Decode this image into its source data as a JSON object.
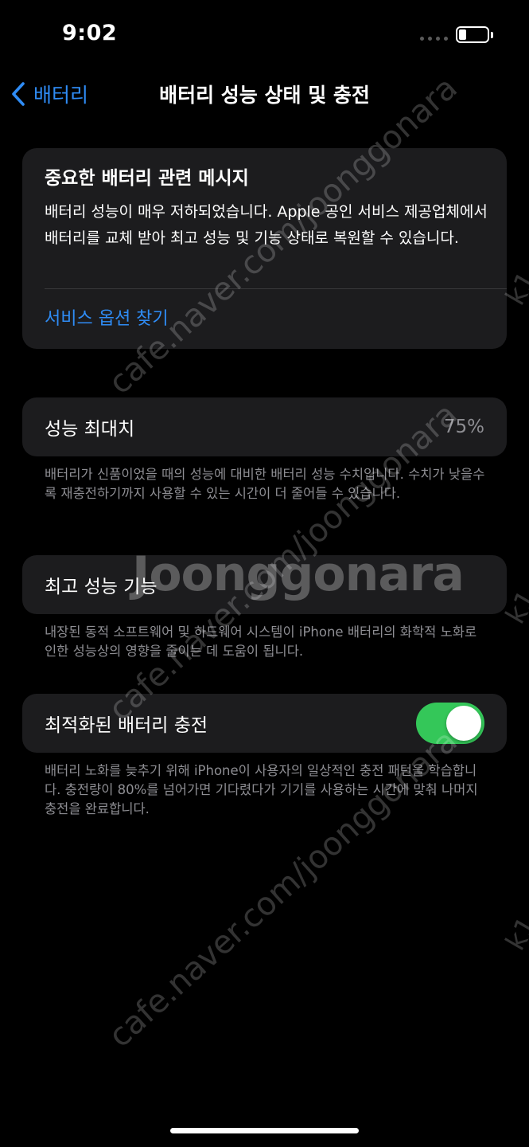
{
  "status_bar": {
    "time": "9:02",
    "battery_level": 0.25
  },
  "nav": {
    "back_label": "배터리",
    "title": "배터리 성능 상태 및 충전"
  },
  "message_card": {
    "title": "중요한 배터리 관련 메시지",
    "body": "배터리 성능이 매우 저하되었습니다. Apple 공인 서비스 제공업체에서 배터리를 교체 받아 최고 성능 및 기능 상태로 복원할 수 있습니다.",
    "link": "서비스 옵션 찾기"
  },
  "max_capacity": {
    "label": "성능 최대치",
    "value": "75%",
    "footnote": "배터리가 신품이었을 때의 성능에 대비한 배터리 성능 수치입니다. 수치가 낮을수록 재충전하기까지 사용할 수 있는 시간이 더 줄어들 수 있습니다."
  },
  "peak_performance": {
    "label": "최고 성능 기능",
    "footnote": "내장된 동적 소프트웨어 및 하드웨어 시스템이 iPhone 배터리의 화학적 노화로 인한 성능상의 영향을 줄이는 데 도움이 됩니다."
  },
  "optimized_charging": {
    "label": "최적화된 배터리 충전",
    "enabled": true,
    "footnote": "배터리 노화를 늦추기 위해 iPhone이 사용자의 일상적인 충전 패턴을 학습합니다. 충전량이 80%를 넘어가면 기다렸다가 기기를 사용하는 시간에 맞춰 나머지 충전을 완료합니다."
  },
  "watermarks": {
    "brand": "Joonggonara",
    "cafe_url": "cafe.naver.com/joonggonara",
    "corner": "k1"
  },
  "colors": {
    "accent": "#2f8cf5",
    "toggle_on": "#34c759",
    "card_bg": "#1c1c1e",
    "secondary_text": "#8e8e93"
  }
}
